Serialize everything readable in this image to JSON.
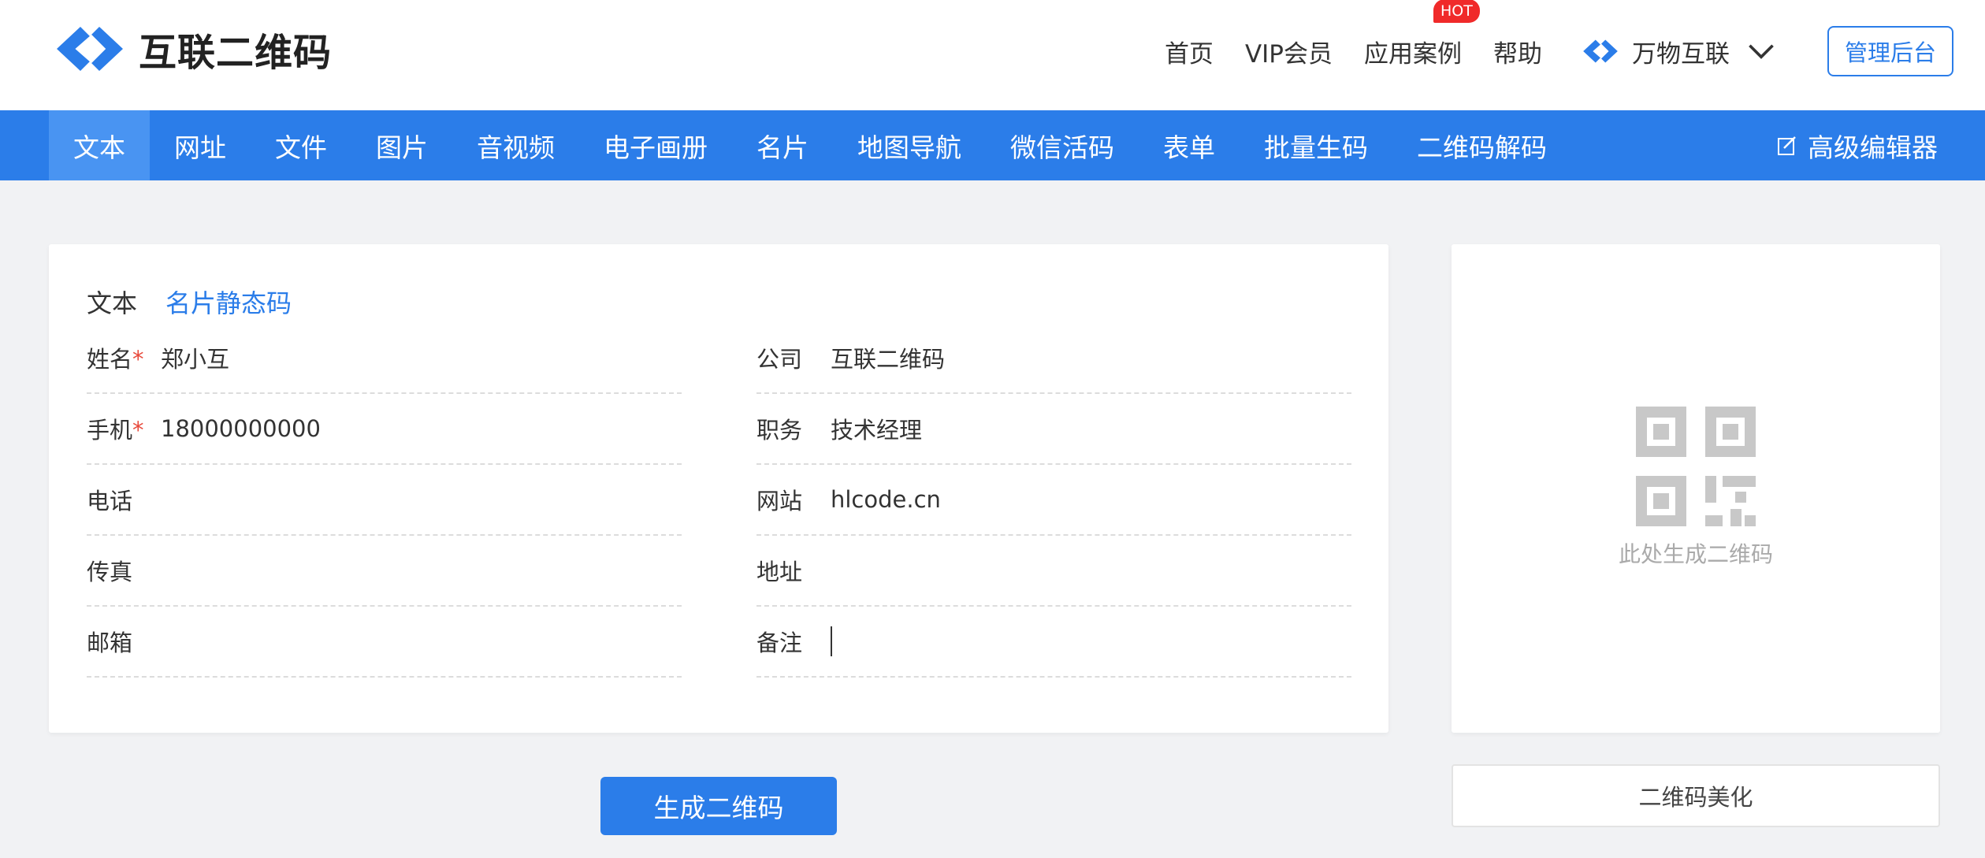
{
  "brand": {
    "name": "互联二维码"
  },
  "topnav": {
    "links": [
      "首页",
      "VIP会员",
      "应用案例",
      "帮助"
    ],
    "hot_badge": "HOT",
    "switcher_label": "万物互联",
    "admin_label": "管理后台"
  },
  "mainnav": {
    "tabs": [
      "文本",
      "网址",
      "文件",
      "图片",
      "音视频",
      "电子画册",
      "名片",
      "地图导航",
      "微信活码",
      "表单",
      "批量生码",
      "二维码解码"
    ],
    "active_tab": "文本",
    "advanced_editor": "高级编辑器"
  },
  "form": {
    "subtabs": [
      "文本",
      "名片静态码"
    ],
    "selected_subtab": "名片静态码",
    "required_mark": "*",
    "fields": {
      "name": {
        "label": "姓名",
        "value": "郑小互"
      },
      "company": {
        "label": "公司",
        "value": "互联二维码"
      },
      "mobile": {
        "label": "手机",
        "value": "18000000000"
      },
      "title": {
        "label": "职务",
        "value": "技术经理"
      },
      "phone": {
        "label": "电话",
        "value": ""
      },
      "website": {
        "label": "网站",
        "value": "hlcode.cn"
      },
      "fax": {
        "label": "传真",
        "value": ""
      },
      "address": {
        "label": "地址",
        "value": ""
      },
      "email": {
        "label": "邮箱",
        "value": ""
      },
      "note": {
        "label": "备注",
        "value": ""
      }
    },
    "generate_label": "生成二维码"
  },
  "preview": {
    "hint": "此处生成二维码",
    "beautify_label": "二维码美化"
  },
  "colors": {
    "accent": "#2b7de9",
    "active_tab": "#4994f2",
    "required": "#e84a3c",
    "hot": "#f02a2a"
  },
  "icons": {
    "logo": "chain-link-logo",
    "switcher": "chain-link-logo",
    "advanced_editor": "edit-icon",
    "dropdown": "chevron-down-icon",
    "qr_placeholder": "qr-code-icon"
  }
}
